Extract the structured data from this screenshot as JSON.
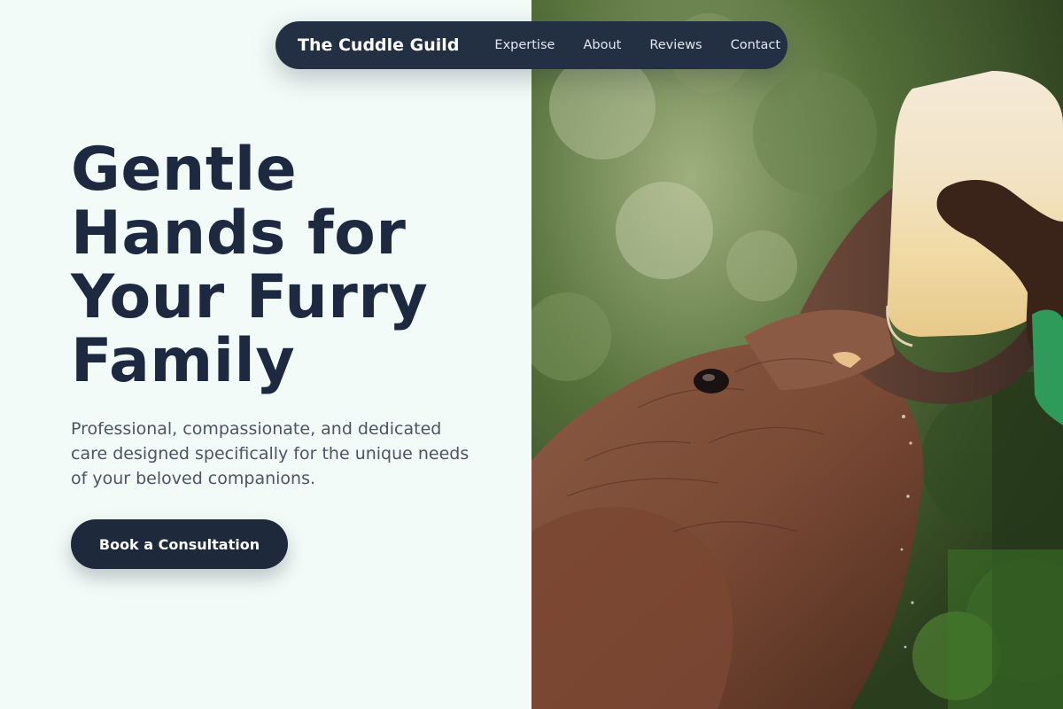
{
  "nav": {
    "brand": "The Cuddle Guild",
    "links": [
      "Expertise",
      "About",
      "Reviews",
      "Contact"
    ]
  },
  "hero": {
    "headline_lines": [
      "Gentle",
      "Hands for",
      "Your Furry",
      "Family"
    ],
    "subtext": "Professional, compassionate, and dedicated care designed specifically for the unique needs of your beloved companions.",
    "cta_label": "Book a Consultation",
    "image_subject": "baby elephant drinking from a milk bottle held by a caretaker"
  },
  "colors": {
    "background": "#f2fbf7",
    "navbar": "#232f42",
    "headline": "#1c2940",
    "body_text": "#4b5563",
    "cta": "#1e293b"
  }
}
